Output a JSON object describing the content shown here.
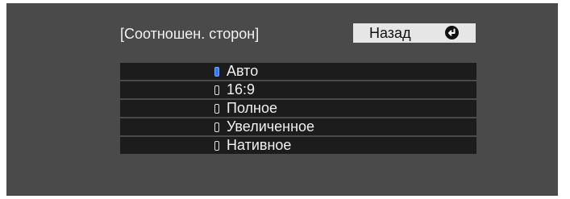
{
  "menu": {
    "title": "[Соотношен. сторон]",
    "back_label": "Назад",
    "back_icon": "return-arrow-icon",
    "options": [
      {
        "label": "Авто",
        "selected": true
      },
      {
        "label": "16:9",
        "selected": false
      },
      {
        "label": "Полное",
        "selected": false
      },
      {
        "label": "Увеличенное",
        "selected": false
      },
      {
        "label": "Нативное",
        "selected": false
      }
    ]
  },
  "colors": {
    "panel_background": "#4a4a4a",
    "row_background": "#1c1c1c",
    "button_background": "#e6e6e6",
    "selected_indicator": "#2d7bff",
    "text": "#f0f0f0"
  }
}
